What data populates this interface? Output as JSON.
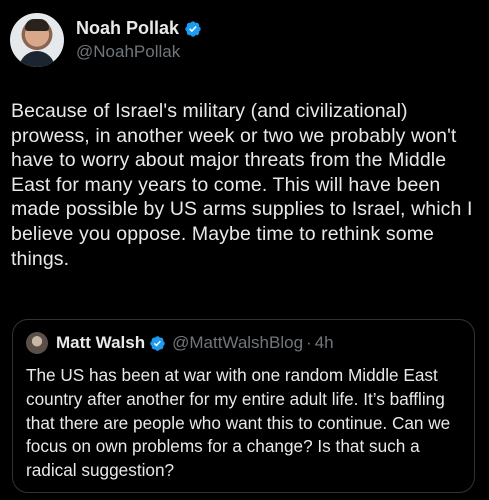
{
  "tweet": {
    "author": {
      "display_name": "Noah Pollak",
      "handle": "@NoahPollak",
      "verified_icon": "verified-badge-icon"
    },
    "text": "Because of Israel's military (and civilizational) prowess, in another week or two we probably won't have to worry about major threats from the Middle East for many years to come. This will have been made possible by US arms supplies to Israel, which I believe you oppose. Maybe time to rethink some things.",
    "quoted_tweet": {
      "display_name": "Matt Walsh",
      "handle": "@MattWalshBlog",
      "separator": "·",
      "time": "4h",
      "text": "The US has been at war with one random Middle East country after another for my entire adult life. It’s baffling that there are people who want this to continue. Can we focus on own problems for a change? Is that such a radical suggestion?"
    }
  },
  "colors": {
    "background": "#000000",
    "primary_text": "#e7e9ea",
    "secondary_text": "#71767b",
    "verified_blue": "#1d9bf0",
    "border": "#2f3336"
  }
}
